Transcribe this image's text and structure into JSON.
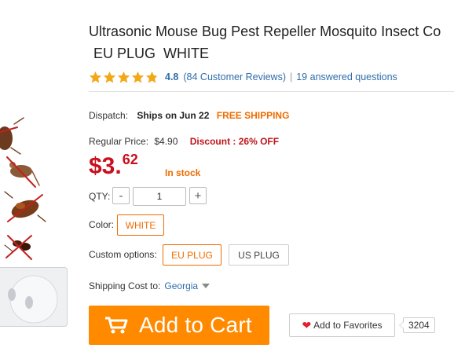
{
  "product": {
    "title_line1": "Ultrasonic Mouse Bug Pest Repeller Mosquito Insect Co",
    "title_line2": "EU PLUG  WHITE"
  },
  "rating": {
    "stars": 4.8,
    "score": "4.8",
    "reviews_link": "(84 Customer Reviews)",
    "separator": "|",
    "answered_link": "19 answered questions"
  },
  "dispatch": {
    "label": "Dispatch:",
    "value": "Ships on Jun 22",
    "free_shipping": "FREE SHIPPING"
  },
  "pricing": {
    "regular_label": "Regular Price:",
    "regular_price": "$4.90",
    "discount": "Discount : 26% OFF",
    "price_main": "$3.",
    "price_cents": "62",
    "stock_status": "In stock"
  },
  "quantity": {
    "label": "QTY:",
    "minus": "-",
    "value": "1",
    "plus": "+"
  },
  "options": {
    "color_label": "Color:",
    "color_selected": "WHITE",
    "custom_label": "Custom options:",
    "custom_values": [
      "EU PLUG",
      "US PLUG"
    ],
    "custom_selected": "EU PLUG"
  },
  "shipping": {
    "label": "Shipping Cost to:",
    "country": "Georgia"
  },
  "actions": {
    "add_to_cart": "Add to Cart",
    "add_to_favorites": "Add to Favorites",
    "favorites_count": "3204"
  },
  "colors": {
    "accent_orange": "#ff8a00",
    "price_red": "#c8101e",
    "link_blue": "#2f6dab",
    "star_gold": "#f3a816"
  },
  "icons": {
    "cart": "cart-icon",
    "heart": "heart-icon",
    "star": "star-icon",
    "caret": "caret-down-icon"
  }
}
